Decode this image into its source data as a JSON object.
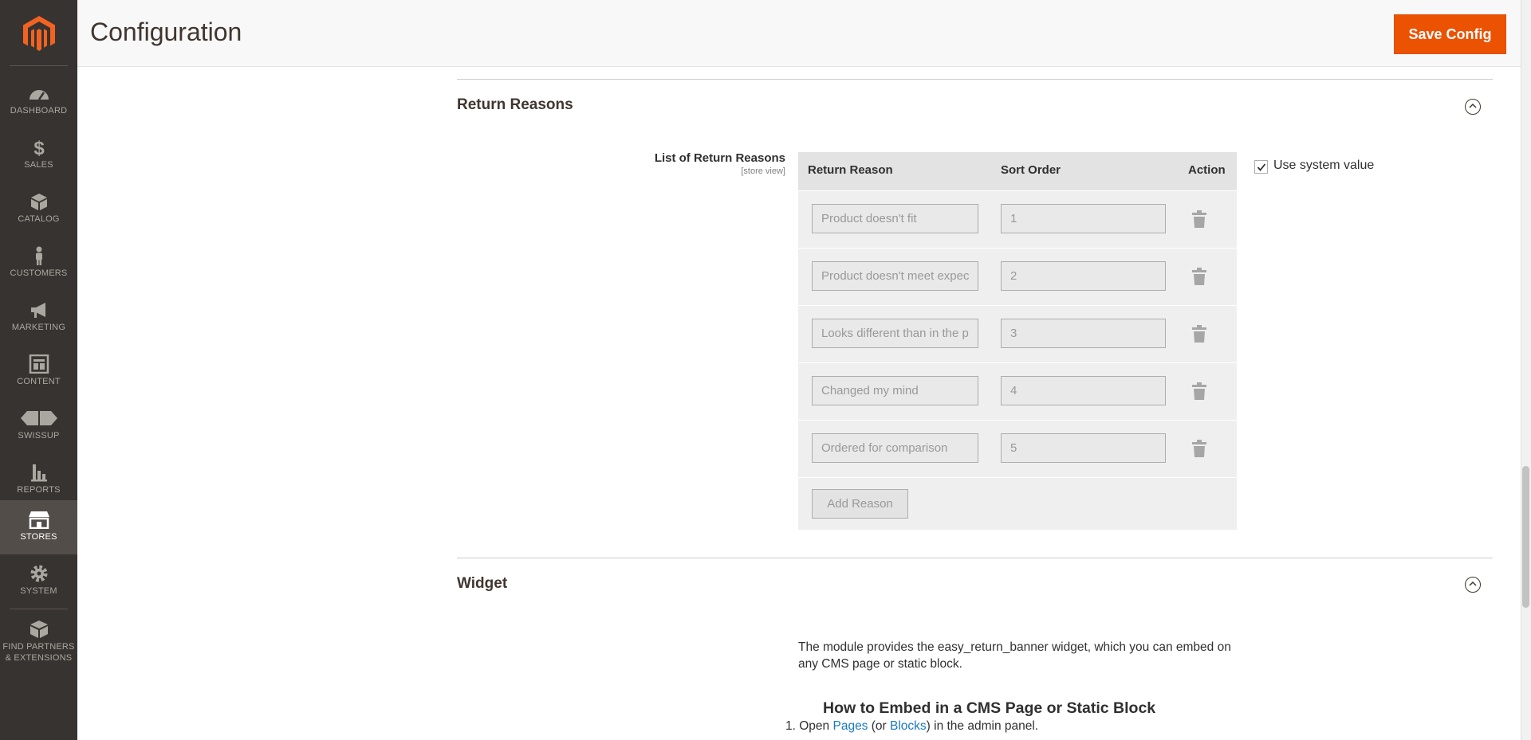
{
  "sidebar": {
    "items": [
      {
        "label": "DASHBOARD",
        "icon": "dashboard-icon"
      },
      {
        "label": "SALES",
        "icon": "dollar-icon"
      },
      {
        "label": "CATALOG",
        "icon": "box-icon"
      },
      {
        "label": "CUSTOMERS",
        "icon": "person-icon"
      },
      {
        "label": "MARKETING",
        "icon": "megaphone-icon"
      },
      {
        "label": "CONTENT",
        "icon": "layout-icon"
      },
      {
        "label": "SWISSUP",
        "icon": "swissup-icon"
      },
      {
        "label": "REPORTS",
        "icon": "bar-chart-icon"
      },
      {
        "label": "STORES",
        "icon": "store-icon"
      },
      {
        "label": "SYSTEM",
        "icon": "gear-icon"
      },
      {
        "label1": "FIND PARTNERS",
        "label2": "& EXTENSIONS",
        "icon": "extensions-icon"
      }
    ],
    "active": "STORES"
  },
  "header": {
    "title": "Configuration",
    "save_label": "Save Config"
  },
  "return_reasons": {
    "section_title": "Return Reasons",
    "field_label": "List of Return Reasons",
    "field_scope": "[store view]",
    "columns": {
      "reason": "Return Reason",
      "sort": "Sort Order",
      "action": "Action"
    },
    "rows": [
      {
        "reason": "Product doesn't fit",
        "sort": "1"
      },
      {
        "reason": "Product doesn't meet expectations",
        "sort": "2"
      },
      {
        "reason": "Looks different than in the picture",
        "sort": "3"
      },
      {
        "reason": "Changed my mind",
        "sort": "4"
      },
      {
        "reason": "Ordered for comparison",
        "sort": "5"
      }
    ],
    "add_label": "Add Reason",
    "use_system_value": "Use system value",
    "use_system_checked": true
  },
  "widget": {
    "section_title": "Widget",
    "description": "The module provides the easy_return_banner widget, which you can embed on any CMS page or static block.",
    "embed_title": "How to Embed in a CMS Page or Static Block",
    "step1": {
      "num": "1.",
      "open": "Open ",
      "pages": "Pages",
      "or": " (or ",
      "blocks": "Blocks",
      "rest": ") in the admin panel."
    }
  },
  "colors": {
    "sidebar_bg": "#373330",
    "active_bg": "#524d49",
    "accent": "#eb5202",
    "link": "#1979c3"
  }
}
